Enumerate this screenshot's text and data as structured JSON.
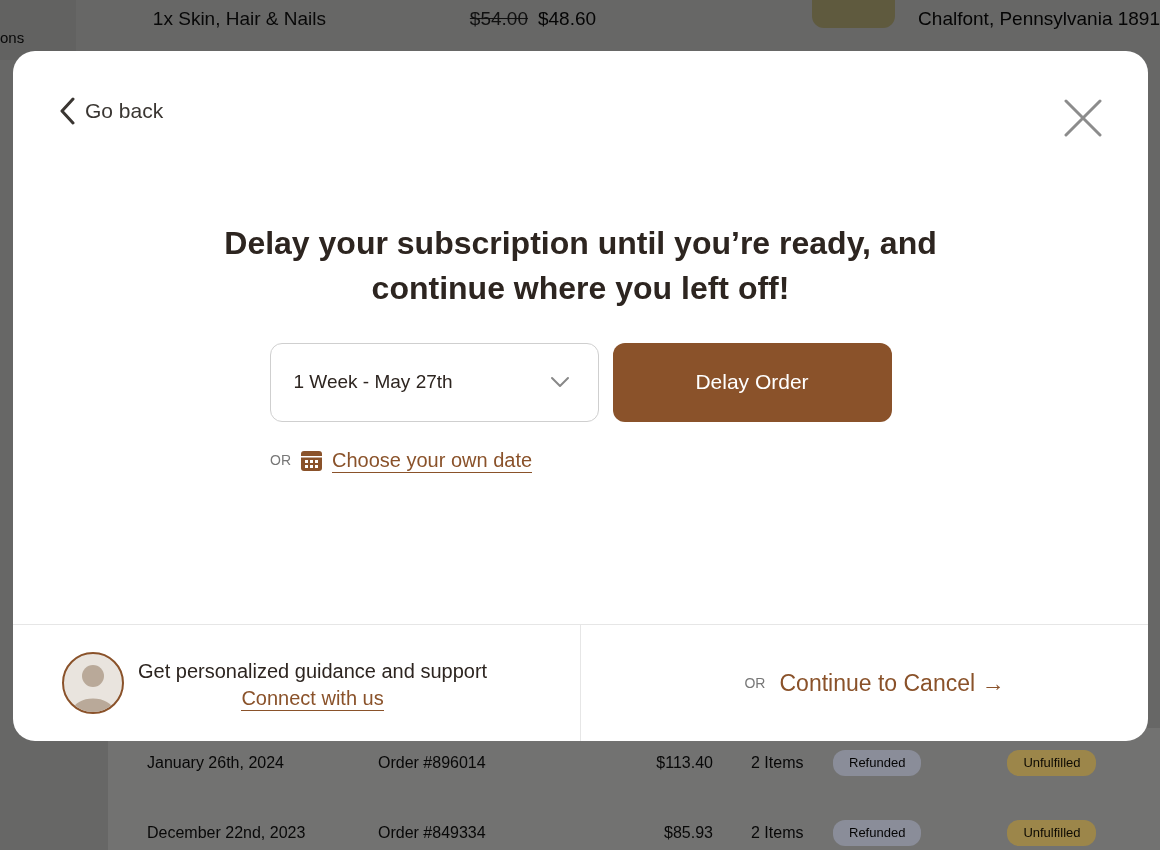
{
  "background": {
    "top_row": {
      "partial_label": "ons",
      "product": "1x Skin, Hair & Nails",
      "original_price": "$54.00",
      "price": "$48.60",
      "address": "Chalfont, Pennsylvania 1891"
    },
    "orders": [
      {
        "date": "January 26th, 2024",
        "order": "Order #896014",
        "total": "$113.40",
        "items": "2 Items",
        "payment_status": "Refunded",
        "fulfillment_status": "Unfulfilled"
      },
      {
        "date": "December 22nd, 2023",
        "order": "Order #849334",
        "total": "$85.93",
        "items": "2 Items",
        "payment_status": "Refunded",
        "fulfillment_status": "Unfulfilled"
      }
    ]
  },
  "modal": {
    "back": "Go back",
    "title": "Delay your subscription until you’re ready, and continue where you left off!",
    "delay_select": {
      "value": "1 Week - May 27th"
    },
    "delay_button": "Delay Order",
    "or_label": "OR",
    "own_date_link": "Choose your own date",
    "support": {
      "text": "Get personalized guidance and support",
      "link": "Connect with us"
    },
    "cancel": {
      "or_label": "OR",
      "link": "Continue to Cancel →"
    }
  }
}
